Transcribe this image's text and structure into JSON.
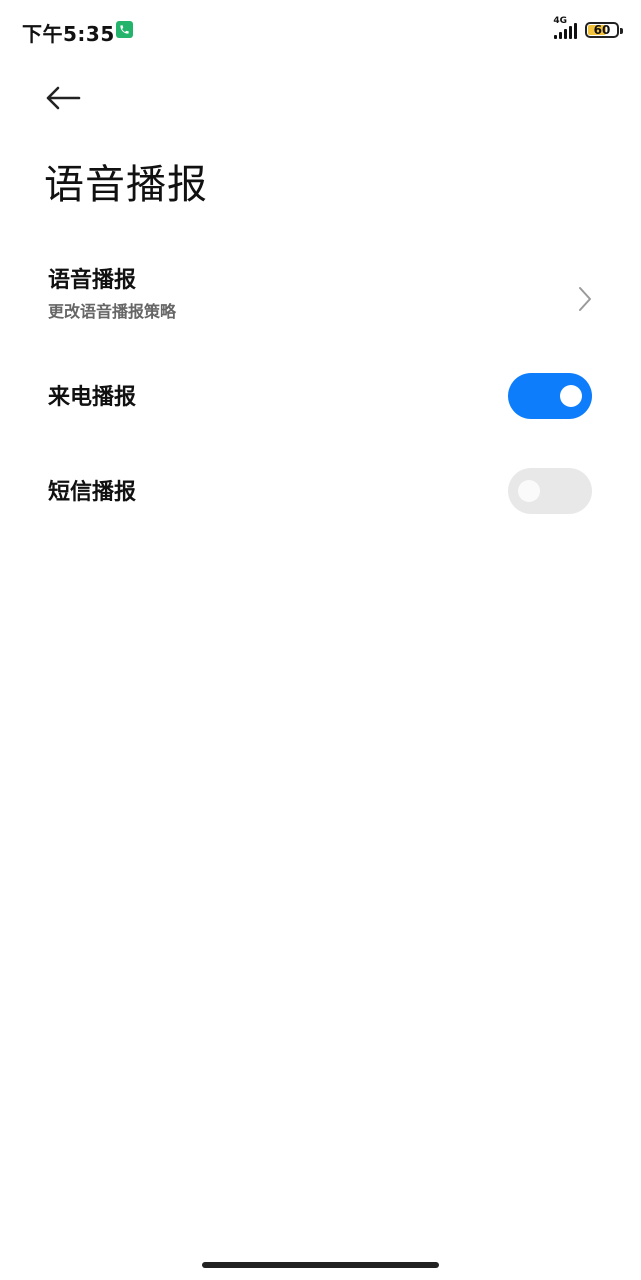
{
  "status_bar": {
    "time": "下午5:35",
    "network_type": "4G",
    "battery_level": "60",
    "call_icon": "phone-icon",
    "signal_icon": "signal-icon",
    "battery_icon": "battery-icon"
  },
  "header": {
    "back_icon": "back-arrow-icon",
    "title": "语音播报"
  },
  "settings": {
    "voice": {
      "title": "语音播报",
      "subtitle": "更改语音播报策略",
      "icon": "chevron-right-icon"
    },
    "incoming_call": {
      "title": "来电播报",
      "enabled": true
    },
    "sms": {
      "title": "短信播报",
      "enabled": false
    }
  },
  "colors": {
    "switch_on": "#0d7dfb",
    "switch_off": "#e8e8e8",
    "call_badge": "#24b36b",
    "battery_fill": "#f2c33b"
  }
}
